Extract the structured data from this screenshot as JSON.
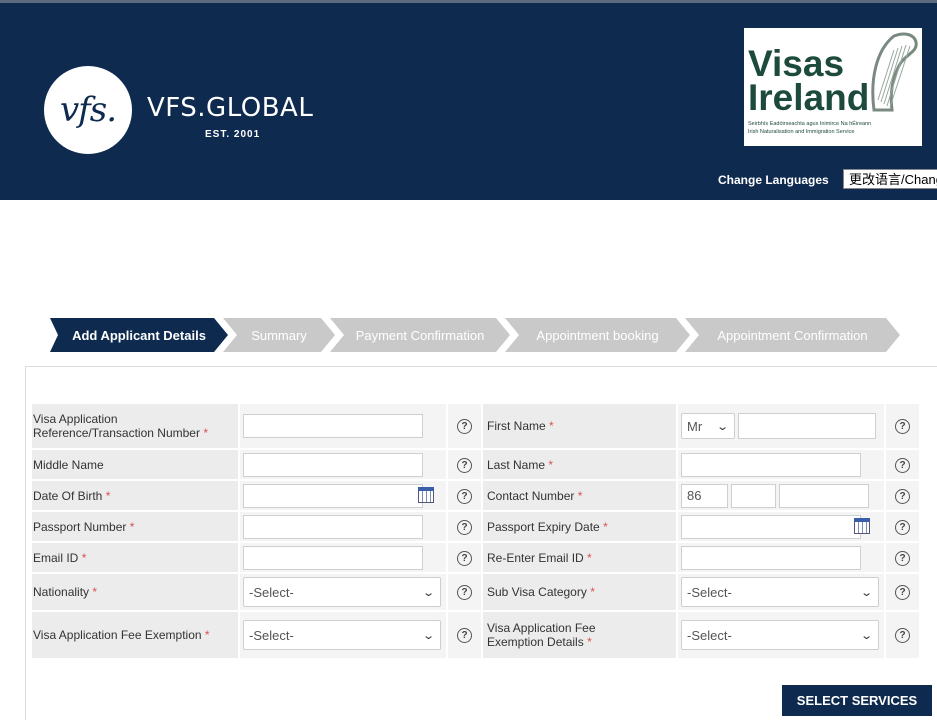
{
  "header": {
    "vfs_logo_text": "vfs.",
    "vfs_name": "VFS.GLOBAL",
    "vfs_est": "EST. 2001",
    "visas_ireland": {
      "line1": "Visas",
      "line2": "Ireland",
      "sub1": "Seirbhís Eadóirseachta agus Inimirce Na hÉireann",
      "sub2": "Irish Naturalisation and Immigration Service"
    },
    "change_languages_label": "Change Languages",
    "language_value": "更改语言/Change"
  },
  "steps": [
    {
      "label": "Add Applicant Details",
      "active": true
    },
    {
      "label": "Summary",
      "active": false
    },
    {
      "label": "Payment Confirmation",
      "active": false
    },
    {
      "label": "Appointment booking",
      "active": false
    },
    {
      "label": "Appointment Confirmation",
      "active": false
    }
  ],
  "form": {
    "visa_ref_label_line1": "Visa Application",
    "visa_ref_label_line2": "Reference/Transaction Number",
    "first_name_label": "First Name",
    "title_value": "Mr",
    "middle_name_label": "Middle Name",
    "last_name_label": "Last Name",
    "dob_label": "Date Of Birth",
    "contact_number_label": "Contact Number",
    "contact_country_code": "86",
    "passport_number_label": "Passport Number",
    "passport_expiry_label": "Passport Expiry Date",
    "email_label": "Email ID",
    "reenter_email_label": "Re-Enter Email ID",
    "nationality_label": "Nationality",
    "nationality_value": "-Select-",
    "sub_visa_label": "Sub Visa Category",
    "sub_visa_value": "-Select-",
    "fee_exemption_label": "Visa Application Fee Exemption",
    "fee_exemption_value": "-Select-",
    "fee_exemption_details_line1": "Visa Application Fee",
    "fee_exemption_details_line2": "Exemption Details",
    "fee_exemption_details_value": "-Select-",
    "required_mark": "*",
    "help_glyph": "?"
  },
  "actions": {
    "select_services_label": "SELECT SERVICES"
  }
}
